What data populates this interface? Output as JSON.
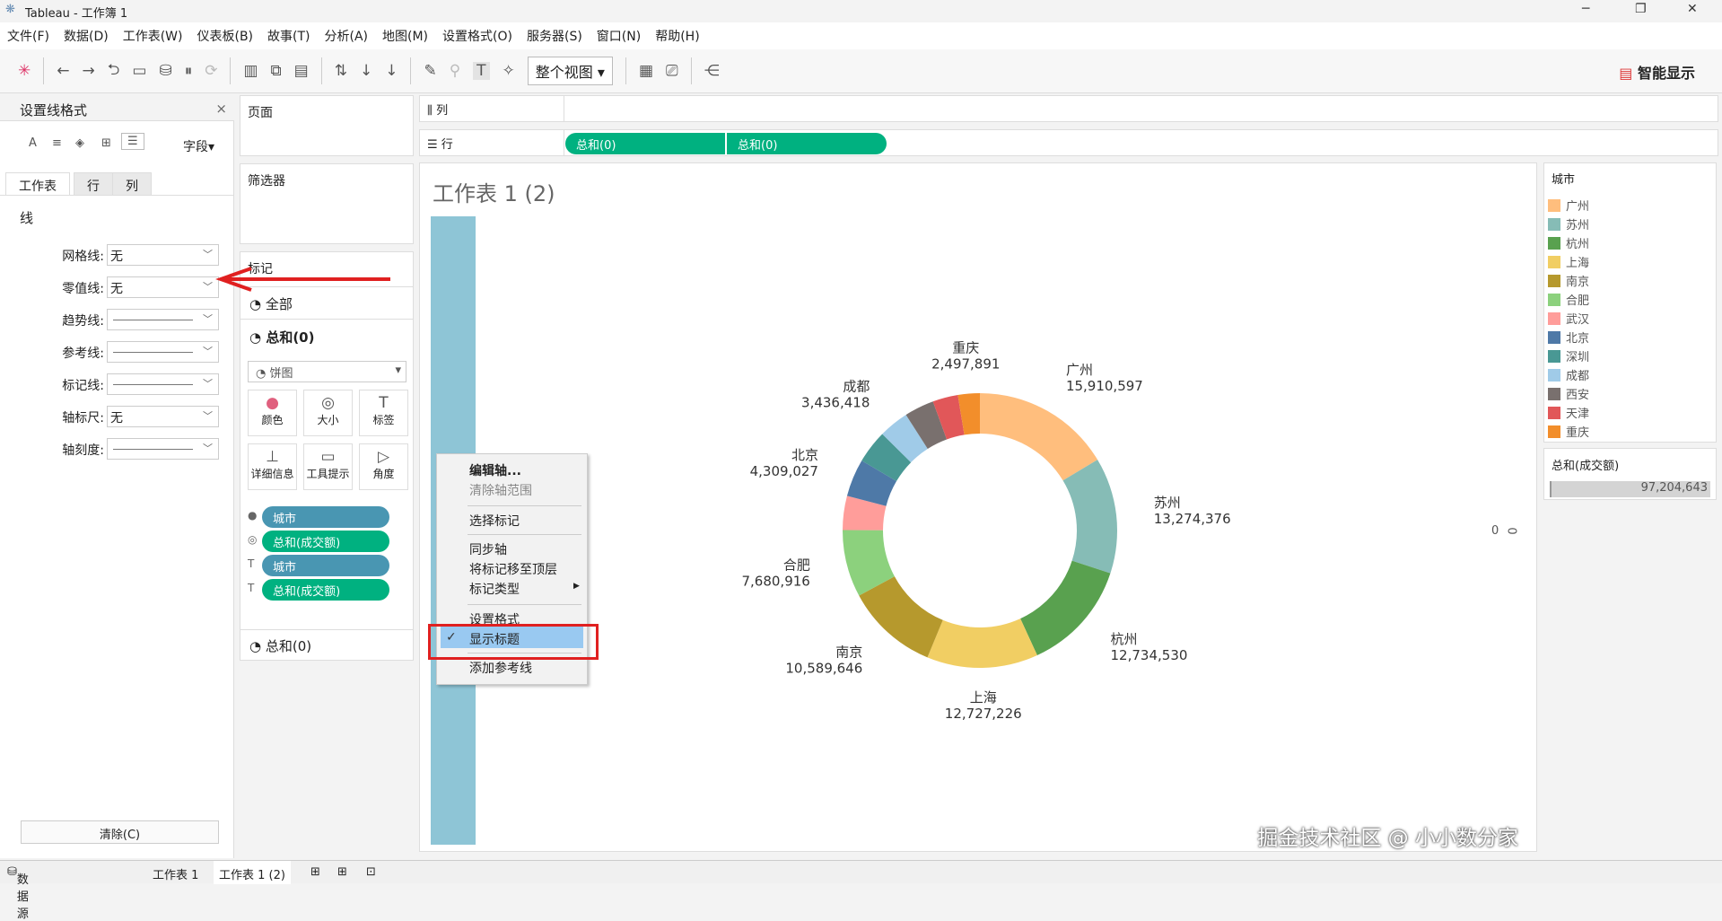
{
  "window": {
    "title": "Tableau - 工作簿 1",
    "minimize": "─",
    "restore": "❐",
    "close": "✕"
  },
  "menu": [
    "文件(F)",
    "数据(D)",
    "工作表(W)",
    "仪表板(B)",
    "故事(T)",
    "分析(A)",
    "地图(M)",
    "设置格式(O)",
    "服务器(S)",
    "窗口(N)",
    "帮助(H)"
  ],
  "toolbar": {
    "fit": "整个视图",
    "smart_show": "智能显示"
  },
  "format_panel": {
    "title": "设置线格式",
    "close": "×",
    "fields": "字段▾",
    "tabs": [
      "工作表",
      "行",
      "列"
    ],
    "section": "线",
    "rows": [
      {
        "label": "网格线:",
        "value": "无"
      },
      {
        "label": "零值线:",
        "value": "无"
      },
      {
        "label": "趋势线:",
        "value": ""
      },
      {
        "label": "参考线:",
        "value": ""
      },
      {
        "label": "标记线:",
        "value": ""
      },
      {
        "label": "轴标尺:",
        "value": "无"
      },
      {
        "label": "轴刻度:",
        "value": ""
      }
    ],
    "clear": "清除(C)"
  },
  "shelves": {
    "pages": "页面",
    "filters": "筛选器",
    "marks": "标记",
    "all": "全部",
    "sum0": "总和(0)",
    "mark_type": "饼图",
    "sum0_b": "总和(0)",
    "buttons": [
      "颜色",
      "大小",
      "标签",
      "详细信息",
      "工具提示",
      "角度"
    ],
    "pills": [
      {
        "label": "城市",
        "color": "#4996b2"
      },
      {
        "label": "总和(成交额)",
        "color": "#00b180"
      },
      {
        "label": "城市",
        "color": "#4996b2"
      },
      {
        "label": "总和(成交额)",
        "color": "#00b180"
      }
    ],
    "columns": "列",
    "rows": "行",
    "row_pills": [
      "总和(0)",
      "总和(0)"
    ]
  },
  "sheet": {
    "title": "工作表 1 (2)",
    "zero_a": "0",
    "zero_b": "0"
  },
  "context_menu": [
    "编辑轴...",
    "清除轴范围",
    "选择标记",
    "同步轴",
    "将标记移至顶层",
    "标记类型",
    "设置格式",
    "显示标题",
    "添加参考线"
  ],
  "context_checked": "✓",
  "legend": {
    "title": "城市",
    "size_title": "总和(成交额)",
    "size_value": "97,204,643"
  },
  "chart_data": {
    "type": "pie",
    "donut": true,
    "total": 97204643,
    "categories": [
      "广州",
      "苏州",
      "杭州",
      "上海",
      "南京",
      "合肥",
      "武汉",
      "北京",
      "深圳",
      "成都",
      "西安",
      "天津",
      "重庆"
    ],
    "values": [
      15910597,
      13274376,
      12734530,
      12727226,
      10589646,
      7680916,
      3900000,
      4309027,
      3800000,
      3436418,
      3400000,
      2900000,
      2497891
    ],
    "labels": [
      "15,910,597",
      "13,274,376",
      "12,734,530",
      "12,727,226",
      "10,589,646",
      "7,680,916",
      null,
      "4,309,027",
      null,
      "3,436,418",
      null,
      null,
      "2,497,891"
    ],
    "colors": [
      "#ffbe7d",
      "#86bcb6",
      "#59a14f",
      "#f1ce63",
      "#b6992d",
      "#8cd17d",
      "#ff9d9a",
      "#4e79a7",
      "#499894",
      "#a0cbe8",
      "#79706e",
      "#e15759",
      "#f28e2b"
    ]
  },
  "bottom_tabs": {
    "datasource": "数据源",
    "tab1": "工作表 1",
    "tab2": "工作表 1 (2)"
  },
  "watermark": "掘金技术社区 @ 小小数分家"
}
